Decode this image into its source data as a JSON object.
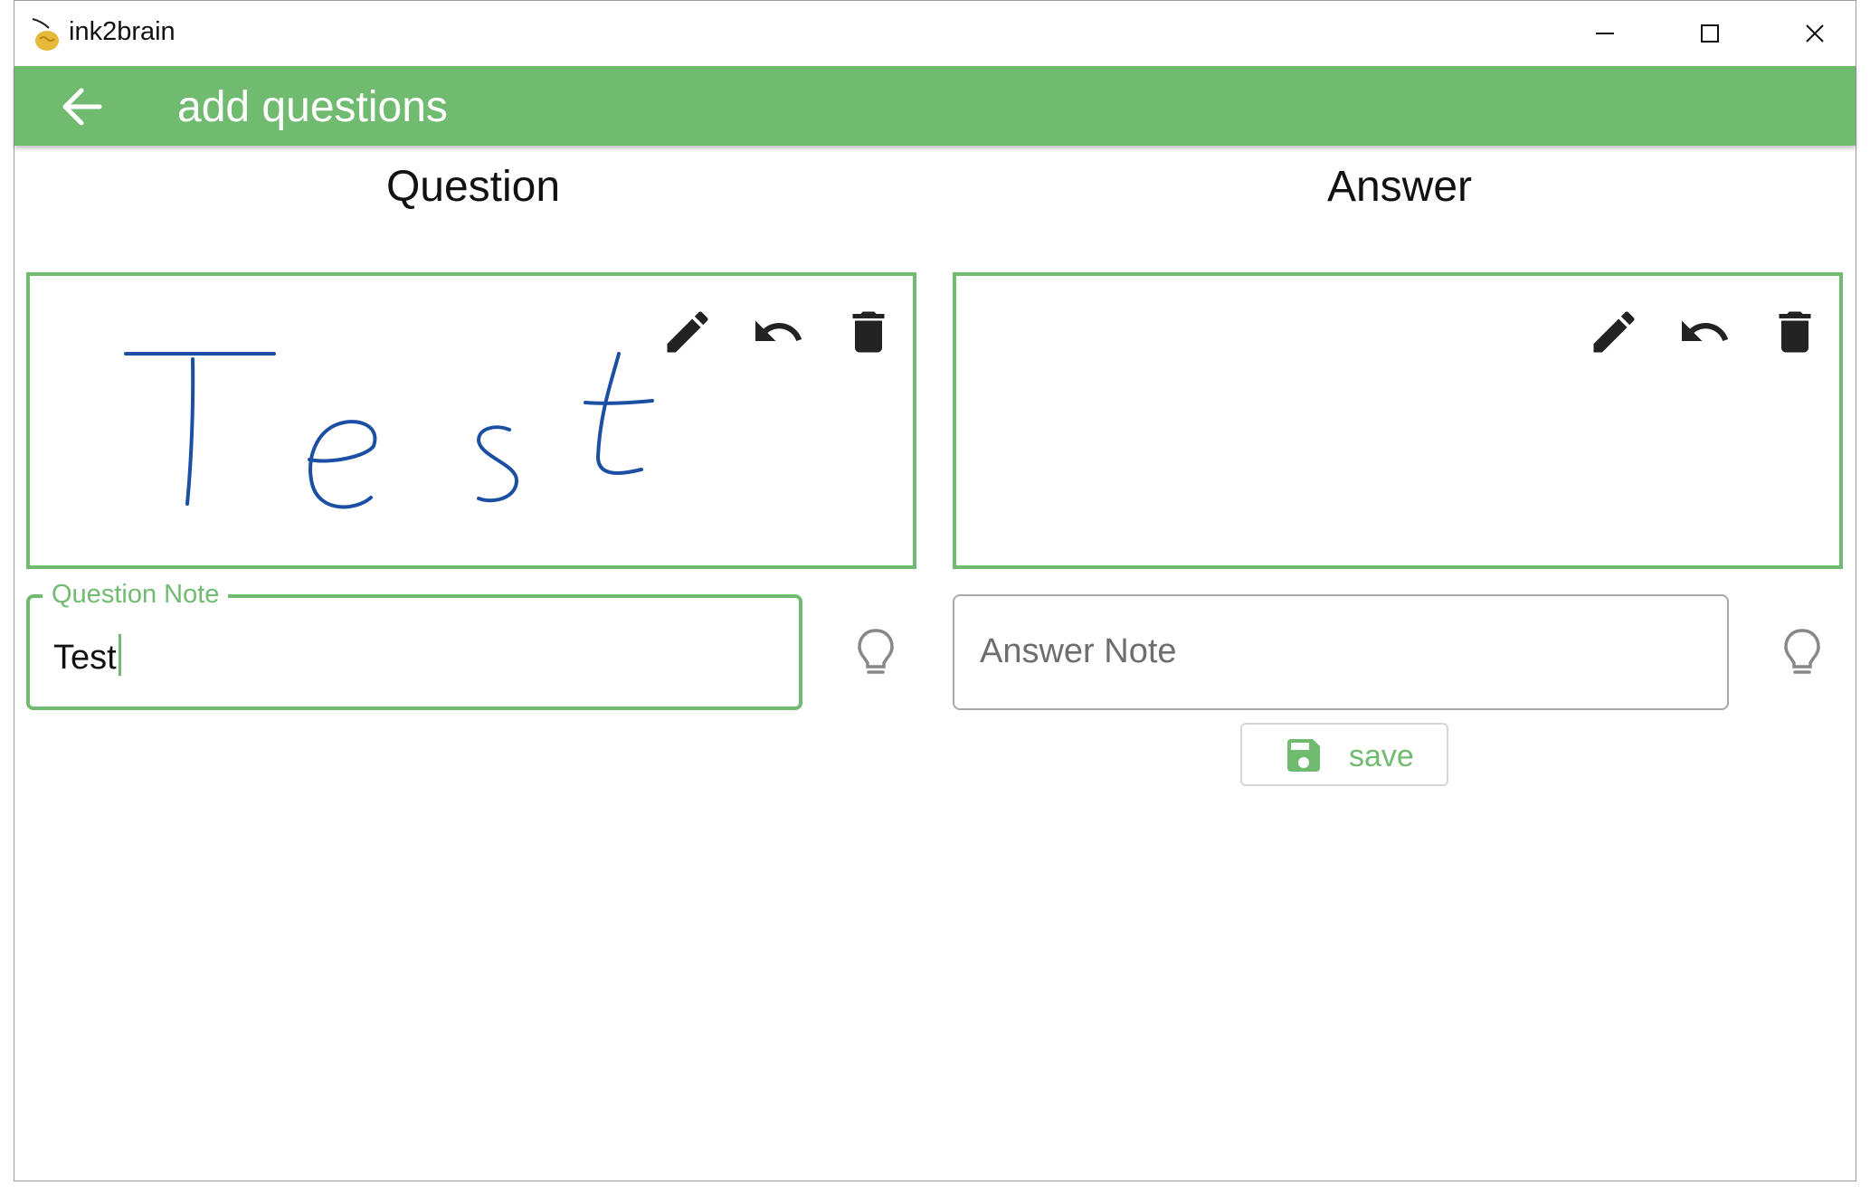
{
  "window": {
    "title": "ink2brain"
  },
  "appbar": {
    "title": "add questions"
  },
  "question": {
    "header": "Question",
    "note_label": "Question Note",
    "note_value": "Test"
  },
  "answer": {
    "header": "Answer",
    "note_placeholder": "Answer Note"
  },
  "actions": {
    "save_label": "save"
  },
  "colors": {
    "accent": "#71bb71",
    "ink": "#1b4fa3"
  },
  "icons": [
    "back-arrow-icon",
    "pen-icon",
    "undo-icon",
    "trash-icon",
    "lightbulb-icon",
    "floppy-disk-icon"
  ]
}
